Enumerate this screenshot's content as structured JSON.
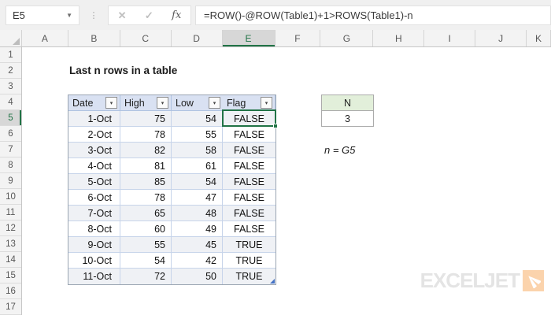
{
  "name_box": {
    "value": "E5"
  },
  "formula_bar": {
    "formula": "=ROW()-@ROW(Table1)+1>ROWS(Table1)-n",
    "cancel": "✕",
    "enter": "✓",
    "fx": "fx"
  },
  "grid": {
    "column_letters": [
      "A",
      "B",
      "C",
      "D",
      "E",
      "F",
      "G",
      "H",
      "I",
      "J",
      "K"
    ],
    "selected_column": "E",
    "row_count": 17,
    "selected_row": 5
  },
  "content": {
    "title": "Last n rows in a table",
    "note": "n = G5"
  },
  "table": {
    "name": "Table1",
    "headers": [
      "Date",
      "High",
      "Low",
      "Flag"
    ],
    "filter_icon": "▾",
    "rows": [
      [
        "1-Oct",
        "75",
        "54",
        "FALSE"
      ],
      [
        "2-Oct",
        "78",
        "55",
        "FALSE"
      ],
      [
        "3-Oct",
        "82",
        "58",
        "FALSE"
      ],
      [
        "4-Oct",
        "81",
        "61",
        "FALSE"
      ],
      [
        "5-Oct",
        "85",
        "54",
        "FALSE"
      ],
      [
        "6-Oct",
        "78",
        "47",
        "FALSE"
      ],
      [
        "7-Oct",
        "65",
        "48",
        "FALSE"
      ],
      [
        "8-Oct",
        "60",
        "49",
        "FALSE"
      ],
      [
        "9-Oct",
        "55",
        "45",
        "TRUE"
      ],
      [
        "10-Oct",
        "54",
        "42",
        "TRUE"
      ],
      [
        "11-Oct",
        "72",
        "50",
        "TRUE"
      ]
    ]
  },
  "n_box": {
    "label": "N",
    "value": "3"
  },
  "logo": {
    "text": "EXCELJET"
  },
  "colors": {
    "accent_green": "#217346",
    "table_header_fill": "#D9E1F2",
    "band_fill": "#EFF1F5",
    "table_border": "#AFC3E1",
    "n_header_fill": "#E2EFDA",
    "logo_orange": "#FBD3AC",
    "logo_gray": "#E4E4E4",
    "resize_handle_blue": "#4472C4"
  }
}
